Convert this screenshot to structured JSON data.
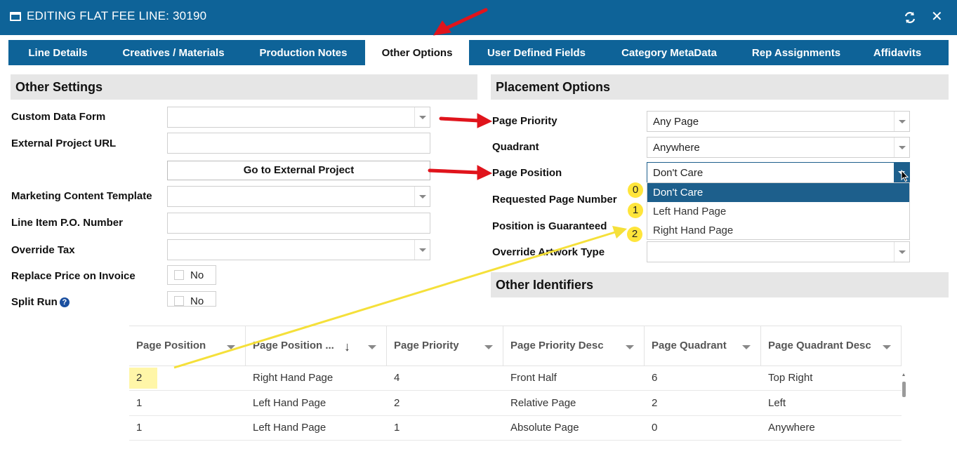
{
  "window": {
    "title": "EDITING FLAT FEE LINE: 30190",
    "icons": [
      "window-icon",
      "refresh-icon",
      "close-icon"
    ]
  },
  "tabs": [
    {
      "label": "Line Details"
    },
    {
      "label": "Creatives / Materials"
    },
    {
      "label": "Production Notes"
    },
    {
      "label": "Other Options",
      "active": true
    },
    {
      "label": "User Defined Fields"
    },
    {
      "label": "Category MetaData"
    },
    {
      "label": "Rep Assignments"
    },
    {
      "label": "Affidavits"
    }
  ],
  "other_settings": {
    "header": "Other Settings",
    "custom_data_form_label": "Custom Data Form",
    "external_project_url_label": "External Project URL",
    "go_external_button": "Go to External Project",
    "marketing_template_label": "Marketing Content Template",
    "po_number_label": "Line Item P.O. Number",
    "override_tax_label": "Override Tax",
    "replace_price_label": "Replace Price on Invoice",
    "replace_price_value": "No",
    "split_run_label": "Split Run",
    "split_run_help": "?",
    "split_run_value": "No"
  },
  "placement": {
    "header": "Placement Options",
    "page_priority_label": "Page Priority",
    "page_priority_value": "Any Page",
    "quadrant_label": "Quadrant",
    "quadrant_value": "Anywhere",
    "page_position_label": "Page Position",
    "page_position_value": "Don't Care",
    "requested_page_label": "Requested Page Number",
    "guaranteed_label": "Position is Guaranteed",
    "override_artwork_label": "Override Artwork Type",
    "dropdown_options": [
      "Don't Care",
      "Left Hand Page",
      "Right Hand Page"
    ],
    "dropdown_selected_index": 0
  },
  "other_identifiers": {
    "header": "Other Identifiers"
  },
  "annotations": {
    "badges": [
      "0",
      "1",
      "2"
    ],
    "arrow_color": "#e0141c",
    "line_color": "#f5e03a"
  },
  "grid": {
    "columns": [
      "Page Position",
      "Page Position ...",
      "Page Priority",
      "Page Priority Desc",
      "Page Quadrant",
      "Page Quadrant Desc"
    ],
    "sort_icon": "arrow-down-icon",
    "rows": [
      [
        "2",
        "Right Hand Page",
        "4",
        "Front Half",
        "6",
        "Top Right"
      ],
      [
        "1",
        "Left Hand Page",
        "2",
        "Relative Page",
        "2",
        "Left"
      ],
      [
        "1",
        "Left Hand Page",
        "1",
        "Absolute Page",
        "0",
        "Anywhere"
      ]
    ]
  },
  "colors": {
    "brand": "#0e6398",
    "selected": "#1d5f8c",
    "section_bg": "#e6e6e6",
    "highlight": "#fff6a8"
  }
}
